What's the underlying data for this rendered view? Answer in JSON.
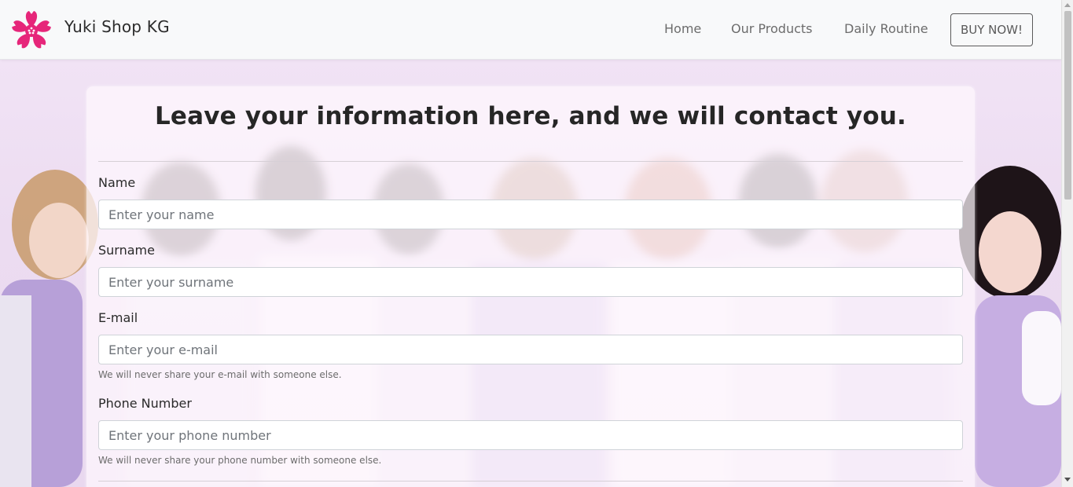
{
  "navbar": {
    "brand": "Yuki Shop KG",
    "logo_icon": "cherry-blossom-icon",
    "brand_color": "#e6267a",
    "links": [
      "Home",
      "Our Products",
      "Daily Routine"
    ],
    "cta": "BUY NOW!"
  },
  "form": {
    "title": "Leave your information here, and we will contact you.",
    "fields": [
      {
        "label": "Name",
        "placeholder": "Enter your name",
        "value": ""
      },
      {
        "label": "Surname",
        "placeholder": "Enter your surname",
        "value": ""
      },
      {
        "label": "E-mail",
        "placeholder": "Enter your e-mail",
        "value": "",
        "help": "We will never share your e-mail with someone else."
      },
      {
        "label": "Phone Number",
        "placeholder": "Enter your phone number",
        "value": "",
        "help": "We will never share your phone number with someone else."
      }
    ]
  }
}
